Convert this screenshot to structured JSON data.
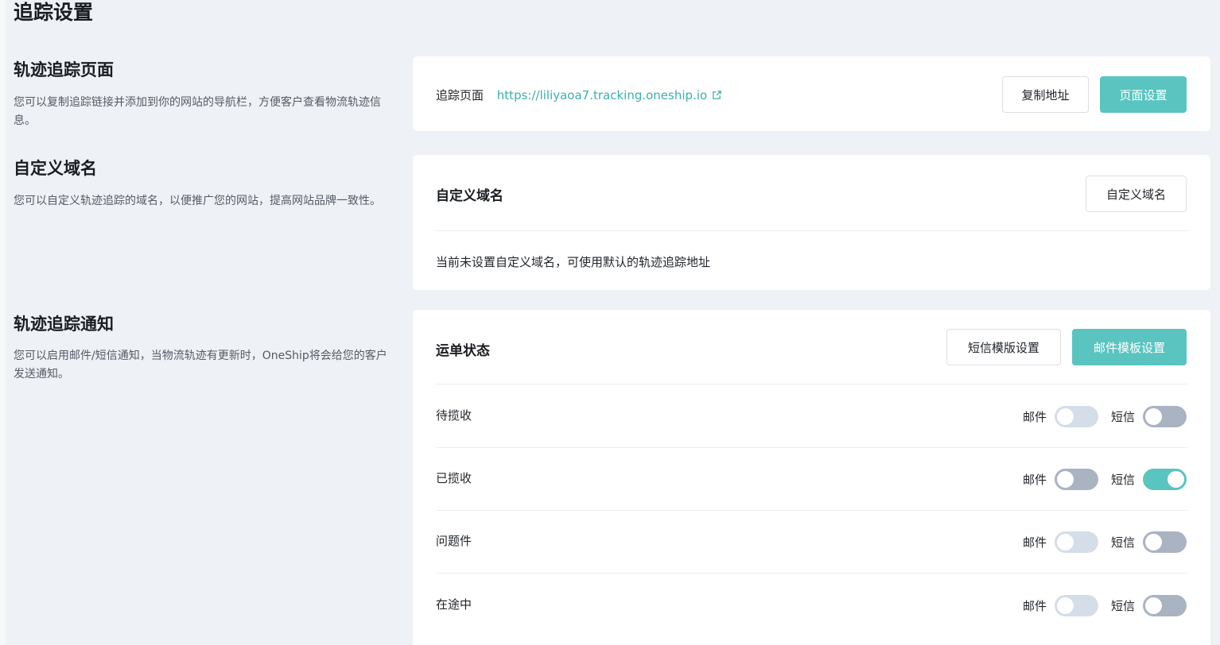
{
  "page": {
    "title": "追踪设置"
  },
  "sections": {
    "tracking_page": {
      "title": "轨迹追踪页面",
      "desc": "您可以复制追踪链接并添加到你的网站的导航栏，方便客户查看物流轨迹信息。",
      "label": "追踪页面",
      "url": "https://liliyaoa7.tracking.oneship.io",
      "copy_button": "复制地址",
      "settings_button": "页面设置"
    },
    "custom_domain": {
      "title": "自定义域名",
      "desc": "您可以自定义轨迹追踪的域名，以便推广您的网站，提高网站品牌一致性。",
      "card_title": "自定义域名",
      "button": "自定义域名",
      "status_text": "当前未设置自定义域名，可使用默认的轨迹追踪地址"
    },
    "notification": {
      "title": "轨迹追踪通知",
      "desc": "您可以启用邮件/短信通知，当物流轨迹有更新时，OneShip将会给您的客户发送通知。",
      "card_title": "运单状态",
      "sms_template_button": "短信模版设置",
      "email_template_button": "邮件模板设置",
      "email_label": "邮件",
      "sms_label": "短信",
      "rows": [
        {
          "label": "待揽收",
          "email_on": false,
          "sms_on": false
        },
        {
          "label": "已揽收",
          "email_on": false,
          "sms_on": true
        },
        {
          "label": "问题件",
          "email_on": false,
          "sms_on": false
        },
        {
          "label": "在途中",
          "email_on": false,
          "sms_on": false
        }
      ]
    }
  },
  "colors": {
    "accent": "#5ac4c0",
    "link": "#3bb0ab",
    "background": "#eef1f5",
    "toggle_off_light": "#d4dde8",
    "toggle_off_dark": "#a9b3c2"
  },
  "icons": {
    "external_link": "external-link-icon"
  }
}
